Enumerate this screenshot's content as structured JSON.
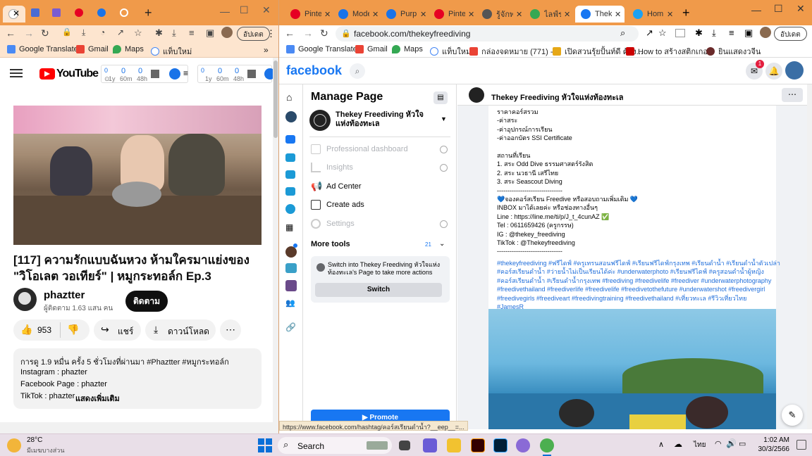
{
  "left_window": {
    "tabs": [
      {
        "label": "",
        "color": "#fff"
      },
      {
        "label": "",
        "color": "#4a6cd4"
      },
      {
        "label": "",
        "color": "#7a5cd0"
      },
      {
        "label": "",
        "color": "#e60023"
      },
      {
        "label": "",
        "color": "#1a73e8"
      },
      {
        "label": "",
        "color": "#888"
      }
    ],
    "bookmarks": [
      "Google Translate",
      "Gmail",
      "Maps",
      "แท็บใหม่"
    ],
    "update_label": "อัปเดต",
    "yt_ext": {
      "a": [
        "0",
        "0",
        "0"
      ],
      "b": [
        "1y",
        "60m",
        "48h"
      ],
      "c": [
        "0",
        "0",
        "0"
      ],
      "d": [
        "1y",
        "60m",
        "48h"
      ]
    },
    "video_title": "[117] ความรักแบบฉันหวง ห้ามใครมาแย่งของ \"วิโอเลต วอเทียร์\" | หมูกระทอล์ก Ep.3",
    "channel": "phaztter",
    "subscribers": "ผู้ติดตาม 1.63 แสน คน",
    "subscribe_label": "ติดตาม",
    "likes": "953",
    "share_label": "แชร์",
    "download_label": "ดาวน์โหลด",
    "desc_meta": "การดู 1.9 หมื่น ครั้ง  5 ชั่วโมงที่ผ่านมา  #Phaztter #หมูกระทอล์ก",
    "desc_lines": [
      "Instagram : phazter",
      "Facebook Page : phazter",
      "TikTok : phazter"
    ],
    "show_more": "แสดงเพิ่มเติม"
  },
  "right_window": {
    "tabs": [
      {
        "label": "Pinte",
        "color": "#e60023"
      },
      {
        "label": "Mode",
        "color": "#1a73e8"
      },
      {
        "label": "Purpl",
        "color": "#1a73e8"
      },
      {
        "label": "Pinte",
        "color": "#e60023"
      },
      {
        "label": "รู้จักพ",
        "color": "#555"
      },
      {
        "label": "ไลฟ์ร",
        "color": "#34a853"
      },
      {
        "label": "Theke",
        "color": "#1877f2"
      },
      {
        "label": "Hom",
        "color": "#1da1f2"
      }
    ],
    "url": "facebook.com/thekeyfreediving",
    "update_label": "อัปเดต",
    "bookmarks": [
      "Google Translate",
      "Gmail",
      "Maps",
      "แท็บใหม่",
      "กล่องจดหมาย (771) -...",
      "เปิดสวนรุ้ยปั้นท์ดี ต้อง...",
      "How to สร้างสติกเกอ...",
      "ยินแสดงวจีน"
    ],
    "fb_logo": "facebook",
    "messenger_badge": "1",
    "manage_page_title": "Manage Page",
    "page_name": "Thekey Freediving หัวใจแห่งท้องทะเล",
    "menu": [
      {
        "label": "Professional dashboard",
        "disabled": true
      },
      {
        "label": "Insights",
        "disabled": true
      },
      {
        "label": "Ad Center",
        "disabled": false
      },
      {
        "label": "Create ads",
        "disabled": false
      },
      {
        "label": "Settings",
        "disabled": true
      }
    ],
    "more_tools": "More tools",
    "more_tools_count": "21",
    "switch_text": "Switch into Thekey Freediving หัวใจแห่งท้องทะเล's Page to take more actions",
    "switch_label": "Switch",
    "promote_label": "Promote",
    "post_header": "Thekey Freediving หัวใจแห่งท้องทะเล",
    "post_lines": [
      {
        "t": "ราคาคอร์สรวม",
        "hl": false
      },
      {
        "t": "-ค่าสระ",
        "hl": false
      },
      {
        "t": "-ค่าอุปกรณ์การเรียน",
        "hl": false
      },
      {
        "t": "-ค่าออกบัตร SSI Certificate",
        "hl": false
      },
      {
        "t": "",
        "hl": false
      },
      {
        "t": "สถานที่เรียน",
        "hl": false
      },
      {
        "t": "1. สระ Odd Dive ธรรมศาสตร์รังสิต",
        "hl": false
      },
      {
        "t": "2. สระ นวธานี เสรีไทย",
        "hl": false
      },
      {
        "t": "3. สระ Seascout Diving",
        "hl": false
      },
      {
        "t": "-------------------------------",
        "hl": false
      },
      {
        "t": "💙จองคอร์สเรียน Freedive หรือสอบถามเพิ่มเติม 💙",
        "hl": false
      },
      {
        "t": "INBOX มาได้เลยค่ะ หรือช่องทางอื่นๆ",
        "hl": false
      },
      {
        "t": "Line : https://line.me/ti/p/J_t_4cunAZ ✅",
        "hl": false
      },
      {
        "t": "Tel : 0611659426 (ครูกรรษ)",
        "hl": false
      },
      {
        "t": "IG : @thekey_freediving",
        "hl": false
      },
      {
        "t": "TikTok : @Thekeyfreediving",
        "hl": false
      },
      {
        "t": "-------------------------------",
        "hl": false
      },
      {
        "t": "#thekeyfreediving #ฟรีไดฟ์ #ครูเทรนสอนฟรีไดฟ์ #เรียนฟรีไดฟ์กรุงเทพ #เรียนดำน้ำ #เรียนดำน้ำตัวเปล่า",
        "hl": true
      },
      {
        "t": "#คอร์สเรียนดำน้ำ #ว่ายน้ำไม่เป็นเรียนได้ค่ะ #underwaterphoto #เรียนฟรีไดฟ์  #ครูสอนดำน้ำผู้หญิง",
        "hl": true
      },
      {
        "t": "#คอร์สเรียนดำน้ำ #เรียนดำน้ำกรุงเทพ #freediving #freedivelife #freediver #underwaterphotography",
        "hl": true
      },
      {
        "t": "#freedivethailand  #freediverlife #freedivelife #freedivetothefuture #underwatershot #freedivergirl",
        "hl": true
      },
      {
        "t": "#freedivegirls #freediveart #freedivingtraining #freedivethailand #เที่ยวทะเล #รีวิวเที่ยวไทย",
        "hl": true
      },
      {
        "t": "#JamesR",
        "hl": true
      }
    ],
    "status_url": "https://www.facebook.com/hashtag/คอร์สเรียนดำน้ำ?__eep__=..."
  },
  "taskbar": {
    "weather_temp": "28°C",
    "weather_desc": "มีเมฆบางส่วน",
    "search_label": "Search",
    "lang": "ไทย",
    "time": "1:02 AM",
    "date": "30/3/2566"
  }
}
